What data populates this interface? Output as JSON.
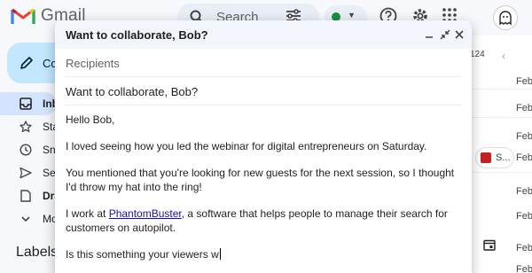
{
  "app": {
    "name": "Gmail",
    "search_placeholder": "Search"
  },
  "sidebar": {
    "compose_label": "Compose",
    "items": [
      {
        "label": "Inbox",
        "icon": "inbox-icon"
      },
      {
        "label": "Starred",
        "icon": "star-icon"
      },
      {
        "label": "Snoozed",
        "icon": "clock-icon"
      },
      {
        "label": "Sent",
        "icon": "send-icon"
      },
      {
        "label": "Drafts",
        "icon": "draft-icon"
      },
      {
        "label": "More",
        "icon": "chevron-down-icon"
      }
    ],
    "labels_heading": "Labels"
  },
  "list": {
    "count": "124",
    "dates": [
      "Feb",
      "Feb",
      "Feb",
      "Feb",
      "Feb",
      "Feb",
      "Feb",
      "Feb",
      "Feb"
    ],
    "attachment_chip": "S..."
  },
  "compose": {
    "title": "Want to collaborate, Bob?",
    "recipients_placeholder": "Recipients",
    "subject": "Want to collaborate, Bob?",
    "body": {
      "greeting": "Hello Bob,",
      "p1": "I loved seeing how you led the webinar for digital entrepreneurs on Saturday.",
      "p2": "You mentioned that you're looking for new guests for the next session, so I thought I'd throw my hat into the ring!",
      "p3_before": "I work at ",
      "p3_link": "PhantomBuster",
      "p3_after": ", a software that helps people to manage their search for customers on autopilot.",
      "p4": "Is this something your viewers w"
    }
  },
  "colors": {
    "header_bg": "#f2f6fc",
    "compose_button_bg": "#c2e7ff",
    "active_nav_bg": "#d3e3fd",
    "link": "#1a0dab",
    "status_green": "#1e8e3e"
  }
}
